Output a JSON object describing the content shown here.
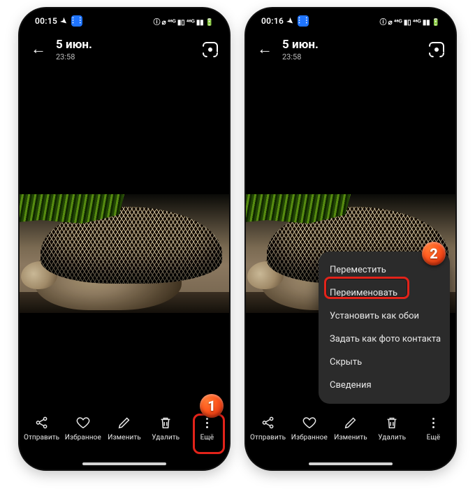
{
  "phones": [
    {
      "statusbar": {
        "time": "00:15",
        "right_cluster": "ⓘ ⌀ ⁴⁶ᴳ ▮▯ ⁴⁶ᴳ ▮▮ 🔋"
      },
      "header": {
        "title": "5 июн.",
        "subtitle": "23:58"
      },
      "actions": {
        "share": "Отправить",
        "favorite": "Избранное",
        "edit": "Изменить",
        "delete": "Удалить",
        "more": "Ещё"
      },
      "callout_number": "1"
    },
    {
      "statusbar": {
        "time": "00:16",
        "right_cluster": "ⓘ ⌀ ⁴⁶ᴳ ▮▯ ⁴⁶ᴳ ▮▮ 🔋"
      },
      "header": {
        "title": "5 июн.",
        "subtitle": "23:58"
      },
      "actions": {
        "share": "Отправить",
        "favorite": "Избранное",
        "edit": "Изменить",
        "delete": "Удалить",
        "more": "Ещё"
      },
      "menu": {
        "move": "Переместить",
        "rename": "Переименовать",
        "wallpaper": "Установить как обои",
        "contact": "Задать как фото контакта",
        "hide": "Скрыть",
        "details": "Сведения"
      },
      "callout_number": "2"
    }
  ]
}
